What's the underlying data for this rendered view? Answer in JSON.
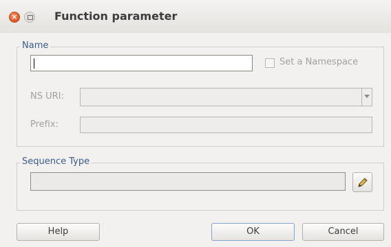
{
  "window": {
    "title": "Function parameter",
    "close_glyph": "×"
  },
  "name_group": {
    "legend": "Name",
    "name_input_value": "",
    "namespace_checkbox_label": "Set a Namespace",
    "namespace_checked": false,
    "ns_uri_label": "NS URI:",
    "ns_uri_value": "",
    "prefix_label": "Prefix:",
    "prefix_value": ""
  },
  "sequence_group": {
    "legend": "Sequence Type",
    "value": "",
    "edit_icon": "pencil-icon"
  },
  "buttons": {
    "help": "Help",
    "ok": "OK",
    "cancel": "Cancel"
  }
}
